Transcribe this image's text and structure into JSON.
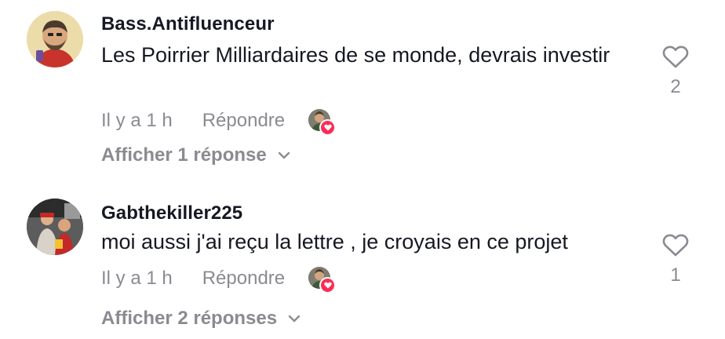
{
  "comments": [
    {
      "username": "Bass.Antifluenceur",
      "text": "Les Poirrier Milliardaires de se monde, devrais investir",
      "time": "Il y a 1 h",
      "reply_label": "Répondre",
      "like_count": "2",
      "view_replies": "Afficher 1 réponse"
    },
    {
      "username": "Gabthekiller225",
      "text": "moi aussi j'ai reçu la lettre , je croyais en ce projet",
      "time": "Il y a 1 h",
      "reply_label": "Répondre",
      "like_count": "1",
      "view_replies": "Afficher 2 réponses"
    }
  ],
  "icons": {
    "like": "heart-outline-icon",
    "chevron": "chevron-down-icon",
    "creator_liked_badge": "heart-badge-icon"
  },
  "colors": {
    "text": "#161823",
    "secondary": "#8a8b91",
    "accent": "#fe2c55"
  }
}
